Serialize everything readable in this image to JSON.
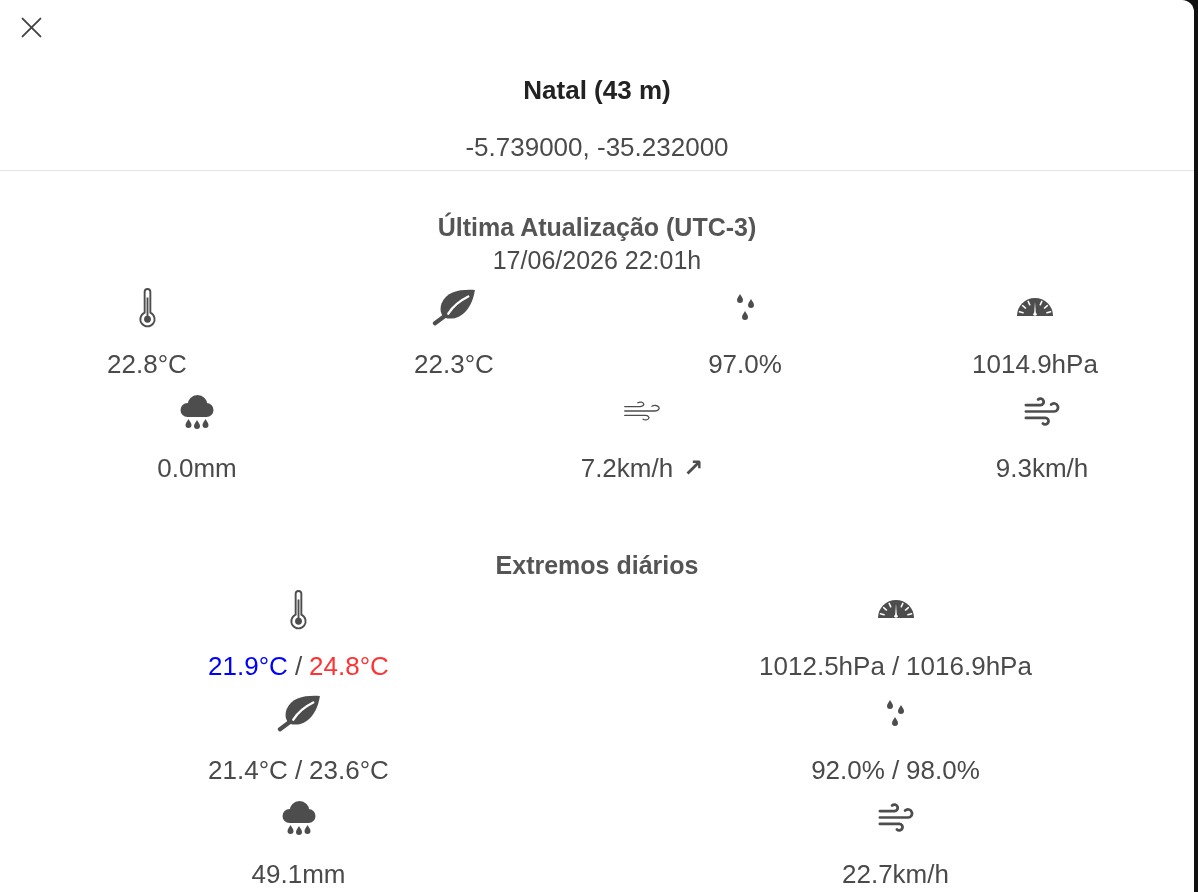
{
  "station": {
    "name": "Natal (43 m)",
    "coordinates": "-5.739000, -35.232000"
  },
  "current": {
    "heading": "Última Atualização (UTC-3)",
    "timestamp": "17/06/2026 22:01h",
    "rows": [
      {
        "readings": [
          {
            "kind": "thermometer",
            "value": "22.8°C"
          },
          {
            "kind": "leaf",
            "value": "22.3°C"
          },
          {
            "kind": "drops",
            "value": "97.0%"
          },
          {
            "kind": "gauge",
            "value": "1014.9hPa"
          }
        ]
      },
      {
        "readings": [
          {
            "kind": "rain",
            "value": "0.0mm"
          },
          {
            "kind": "wind",
            "value": "7.2km/h",
            "direction_arrow": "↗"
          },
          {
            "kind": "gust",
            "value": "9.3km/h"
          }
        ]
      }
    ]
  },
  "daily_extremes": {
    "heading": "Extremos diários",
    "columns": [
      {
        "items": [
          {
            "kind": "thermometer",
            "separator": "/",
            "values": [
              {
                "text": "21.9°C",
                "color": "#0000ff"
              },
              {
                "text": "24.8°C",
                "color": "#ff3333"
              }
            ]
          },
          {
            "kind": "leaf",
            "separator": "/",
            "values": [
              {
                "text": "21.4°C"
              },
              {
                "text": "23.6°C"
              }
            ]
          },
          {
            "kind": "rain",
            "values": [
              {
                "text": "49.1mm"
              }
            ]
          }
        ]
      },
      {
        "items": [
          {
            "kind": "gauge",
            "separator": "/",
            "values": [
              {
                "text": "1012.5hPa"
              },
              {
                "text": "1016.9hPa"
              }
            ]
          },
          {
            "kind": "drops",
            "separator": "/",
            "values": [
              {
                "text": "92.0%"
              },
              {
                "text": "98.0%"
              }
            ]
          },
          {
            "kind": "gust",
            "values": [
              {
                "text": "22.7km/h"
              }
            ]
          }
        ]
      }
    ]
  }
}
